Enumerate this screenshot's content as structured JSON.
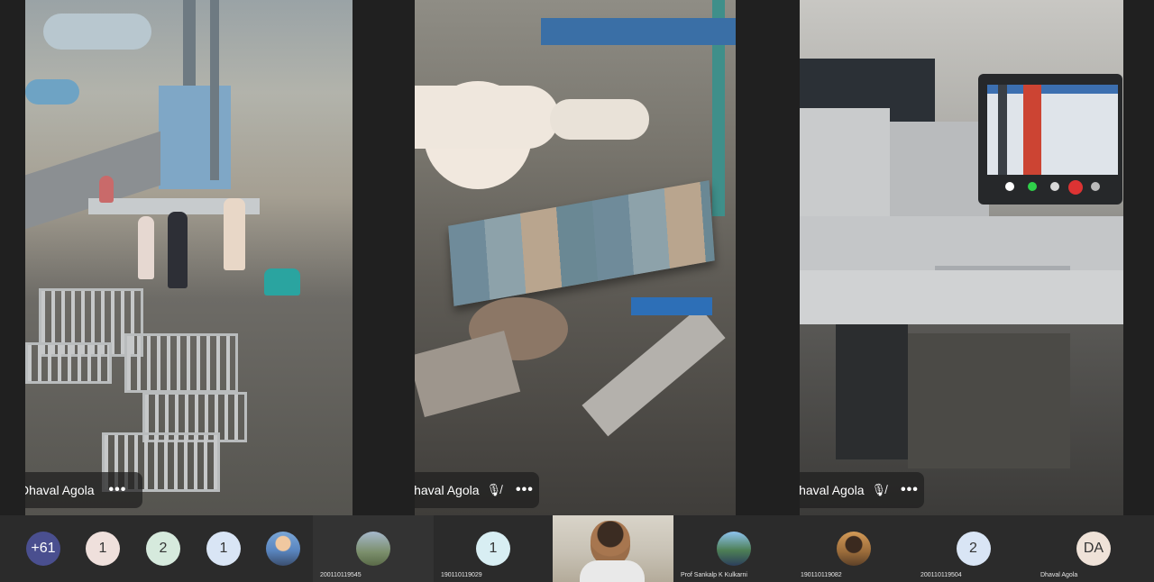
{
  "tiles": [
    {
      "name": "Dhaval Agola",
      "muted": false
    },
    {
      "name": "Dhaval Agola",
      "muted": true
    },
    {
      "name": "Dhaval Agola",
      "muted": true
    }
  ],
  "more_icon": "more-options-icon",
  "participants": [
    {
      "initials": "+61",
      "color": "#4a4f8f",
      "text_color": "#ffffff"
    },
    {
      "initials": "1",
      "color": "#efe0dc",
      "text_color": "#333333"
    },
    {
      "initials": "2",
      "color": "#d6eadd",
      "text_color": "#333333"
    },
    {
      "initials": "1",
      "color": "#d9e5f5",
      "text_color": "#333333"
    },
    {
      "type": "photo"
    },
    {
      "type": "photo",
      "label": "200110119545"
    },
    {
      "initials": "1",
      "color": "#d8eef3",
      "text_color": "#333333",
      "label": "190110119029"
    },
    {
      "type": "video"
    },
    {
      "type": "photo",
      "label": "Prof Sankalp K Kulkarni"
    },
    {
      "type": "photo",
      "label": "190110119082"
    },
    {
      "initials": "2",
      "color": "#d9e5f5",
      "text_color": "#333333",
      "label": "200110119504"
    },
    {
      "initials": "DA",
      "color": "#efe2d8",
      "text_color": "#333333",
      "label": "Dhaval Agola"
    }
  ]
}
